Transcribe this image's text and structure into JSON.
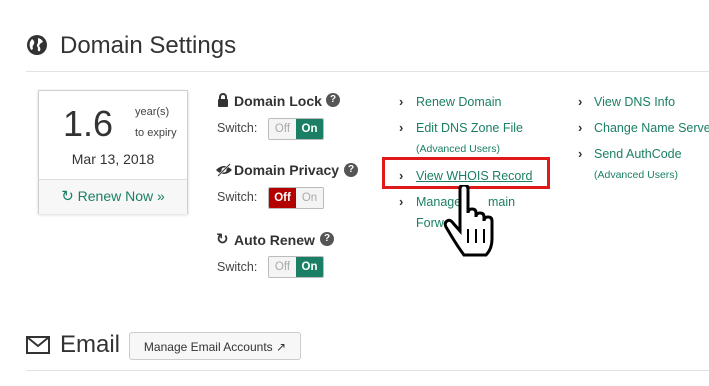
{
  "domain_settings": {
    "title": "Domain Settings",
    "expiry": {
      "value": "1.6",
      "unit_line1": "year(s)",
      "unit_line2": "to expiry",
      "date": "Mar 13, 2018",
      "renew_label": "Renew Now »"
    },
    "domain_lock": {
      "label": "Domain Lock",
      "switch_label": "Switch:",
      "off": "Off",
      "on": "On",
      "state": "on"
    },
    "domain_privacy": {
      "label": "Domain Privacy",
      "switch_label": "Switch:",
      "off": "Off",
      "on": "On",
      "state": "off"
    },
    "auto_renew": {
      "label": "Auto Renew",
      "switch_label": "Switch:",
      "off": "Off",
      "on": "On",
      "state": "on"
    },
    "links_col1": [
      {
        "label": "Renew Domain"
      },
      {
        "label": "Edit DNS Zone File",
        "note": "(Advanced Users)"
      },
      {
        "label": "View WHOIS Record"
      },
      {
        "label": "Manage Domain Forwarding",
        "visible_line1": "Manage",
        "visible_line1b": "main",
        "visible_line2": "Forw"
      }
    ],
    "links_col2": [
      {
        "label": "View DNS Info"
      },
      {
        "label": "Change Name Serve"
      },
      {
        "label": "Send AuthCode",
        "note": "(Advanced Users)"
      }
    ]
  },
  "email": {
    "title": "Email",
    "manage_button": "Manage Email Accounts"
  },
  "colors": {
    "accent": "#1a7f64",
    "off_red": "#b30000",
    "highlight": "#e01a1a"
  }
}
